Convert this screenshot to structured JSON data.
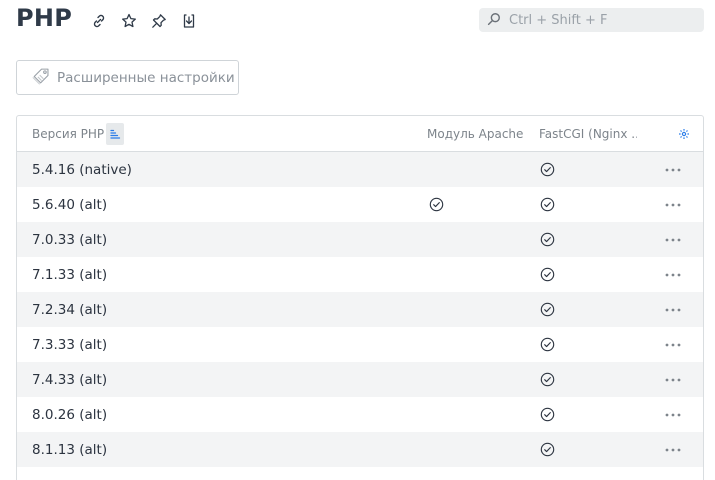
{
  "header": {
    "title": "PHP",
    "icons": [
      "link-icon",
      "star-icon",
      "pin-icon",
      "download-icon"
    ]
  },
  "search": {
    "placeholder": "Ctrl + Shift + F",
    "value": ""
  },
  "advanced_button": {
    "label": "Расширенные настройки",
    "icon": "tag-icon"
  },
  "table": {
    "columns": {
      "version": "Версия PHP",
      "apache": "Модуль Apache",
      "fastcgi": "FastCGI (Nginx ..."
    },
    "rows": [
      {
        "version": "5.4.16 (native)",
        "apache": false,
        "fastcgi": true
      },
      {
        "version": "5.6.40 (alt)",
        "apache": true,
        "fastcgi": true
      },
      {
        "version": "7.0.33 (alt)",
        "apache": false,
        "fastcgi": true
      },
      {
        "version": "7.1.33 (alt)",
        "apache": false,
        "fastcgi": true
      },
      {
        "version": "7.2.34 (alt)",
        "apache": false,
        "fastcgi": true
      },
      {
        "version": "7.3.33 (alt)",
        "apache": false,
        "fastcgi": true
      },
      {
        "version": "7.4.33 (alt)",
        "apache": false,
        "fastcgi": true
      },
      {
        "version": "8.0.26 (alt)",
        "apache": false,
        "fastcgi": true
      },
      {
        "version": "8.1.13 (alt)",
        "apache": false,
        "fastcgi": true
      }
    ]
  },
  "colors": {
    "accent": "#2b7de9",
    "text": "#2c3440",
    "muted": "#8a9199",
    "row_alt": "#f3f4f5"
  }
}
